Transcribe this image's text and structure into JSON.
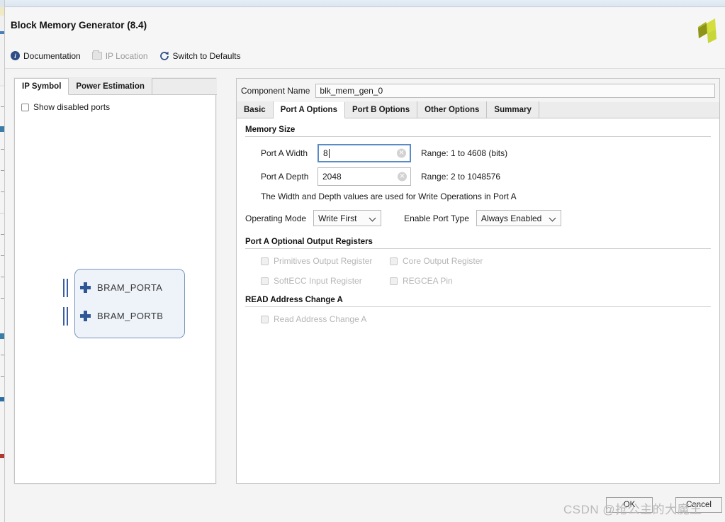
{
  "window": {
    "title": "Block Memory Generator (8.4)",
    "logo_icon": "xilinx-logo"
  },
  "toolbar": {
    "items": [
      {
        "label": "Documentation",
        "icon": "info-icon",
        "enabled": true
      },
      {
        "label": "IP Location",
        "icon": "folder-icon",
        "enabled": false
      },
      {
        "label": "Switch to Defaults",
        "icon": "refresh-icon",
        "enabled": true
      }
    ]
  },
  "left_panel": {
    "tabs": [
      {
        "label": "IP Symbol",
        "active": true
      },
      {
        "label": "Power Estimation",
        "active": false
      }
    ],
    "show_disabled_ports": {
      "label": "Show disabled ports",
      "checked": false
    },
    "symbol": {
      "ports": [
        {
          "name": "BRAM_PORTA",
          "expander": "plus-icon"
        },
        {
          "name": "BRAM_PORTB",
          "expander": "plus-icon"
        }
      ]
    }
  },
  "component": {
    "name_label": "Component Name",
    "name_value": "blk_mem_gen_0"
  },
  "tabs": [
    {
      "label": "Basic",
      "active": false
    },
    {
      "label": "Port A Options",
      "active": true
    },
    {
      "label": "Port B Options",
      "active": false
    },
    {
      "label": "Other Options",
      "active": false
    },
    {
      "label": "Summary",
      "active": false
    }
  ],
  "port_a": {
    "memory_size": {
      "group_title": "Memory Size",
      "width": {
        "label": "Port A Width",
        "value": "8",
        "range": "Range: 1 to 4608 (bits)",
        "focused": true
      },
      "depth": {
        "label": "Port A Depth",
        "value": "2048",
        "range": "Range: 2 to 1048576",
        "focused": false
      },
      "note": "The Width and Depth values are used for Write Operations in Port A"
    },
    "operating_mode": {
      "label": "Operating Mode",
      "value": "Write First"
    },
    "enable_port_type": {
      "label": "Enable Port Type",
      "value": "Always Enabled"
    },
    "optional_output_registers": {
      "group_title": "Port A Optional Output Registers",
      "checkboxes": [
        {
          "label": "Primitives Output Register",
          "checked": false,
          "enabled": false
        },
        {
          "label": "Core Output Register",
          "checked": false,
          "enabled": false
        },
        {
          "label": "SoftECC Input Register",
          "checked": false,
          "enabled": false
        },
        {
          "label": "REGCEA Pin",
          "checked": false,
          "enabled": false
        }
      ]
    },
    "read_address_change": {
      "group_title": "READ Address Change A",
      "checkbox": {
        "label": "Read Address Change A",
        "checked": false,
        "enabled": false
      }
    }
  },
  "footer": {
    "ok_label": "OK",
    "cancel_label": "Cancel"
  },
  "watermark": {
    "text": "CSDN @抢公主的大魔王"
  },
  "colors": {
    "accent_blue": "#2e4d86",
    "focus_blue": "#5b8bc4",
    "symbol_fill": "#eef3fa",
    "symbol_border": "#7a96bd",
    "logo_green": "#a8c02a"
  }
}
